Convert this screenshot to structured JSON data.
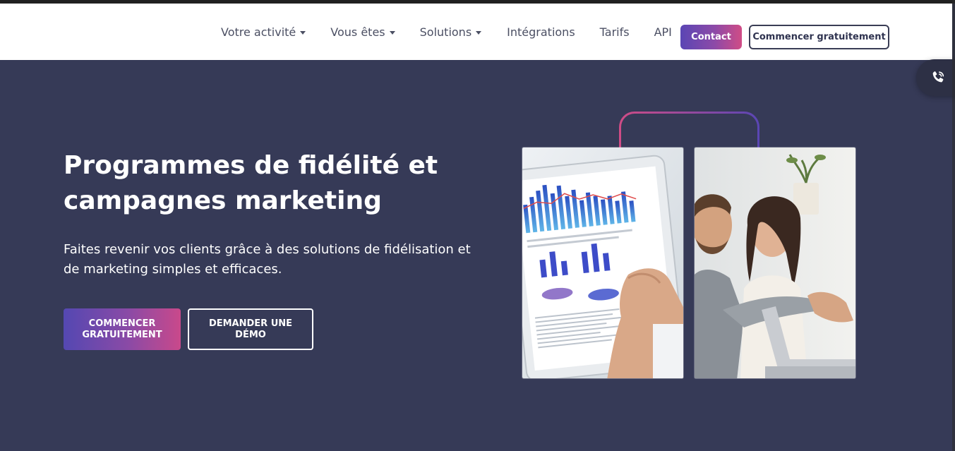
{
  "nav": {
    "items": [
      {
        "label": "Votre activité",
        "dropdown": true
      },
      {
        "label": "Vous êtes",
        "dropdown": true
      },
      {
        "label": "Solutions",
        "dropdown": true
      },
      {
        "label": "Intégrations",
        "dropdown": false
      },
      {
        "label": "Tarifs",
        "dropdown": false
      },
      {
        "label": "API",
        "dropdown": false
      }
    ],
    "contact_label": "Contact",
    "start_label": "Commencer gratuitement"
  },
  "hero": {
    "title": "Programmes de fidélité et campagnes marketing",
    "subtitle": "Faites revenir vos clients grâce à des solutions de fidélisation et de marketing simples et efficaces.",
    "cta_primary": "COMMENCER GRATUITEMENT",
    "cta_secondary": "DEMANDER UNE DÉMO"
  },
  "icons": {
    "phone": "phone-ringing-icon",
    "caret": "caret-down-icon"
  },
  "colors": {
    "header_bg": "#ffffff",
    "hero_bg": "#363a57",
    "gradient_start": "#5a46b4",
    "gradient_end": "#d04c86",
    "nav_text": "#4b4f63"
  }
}
